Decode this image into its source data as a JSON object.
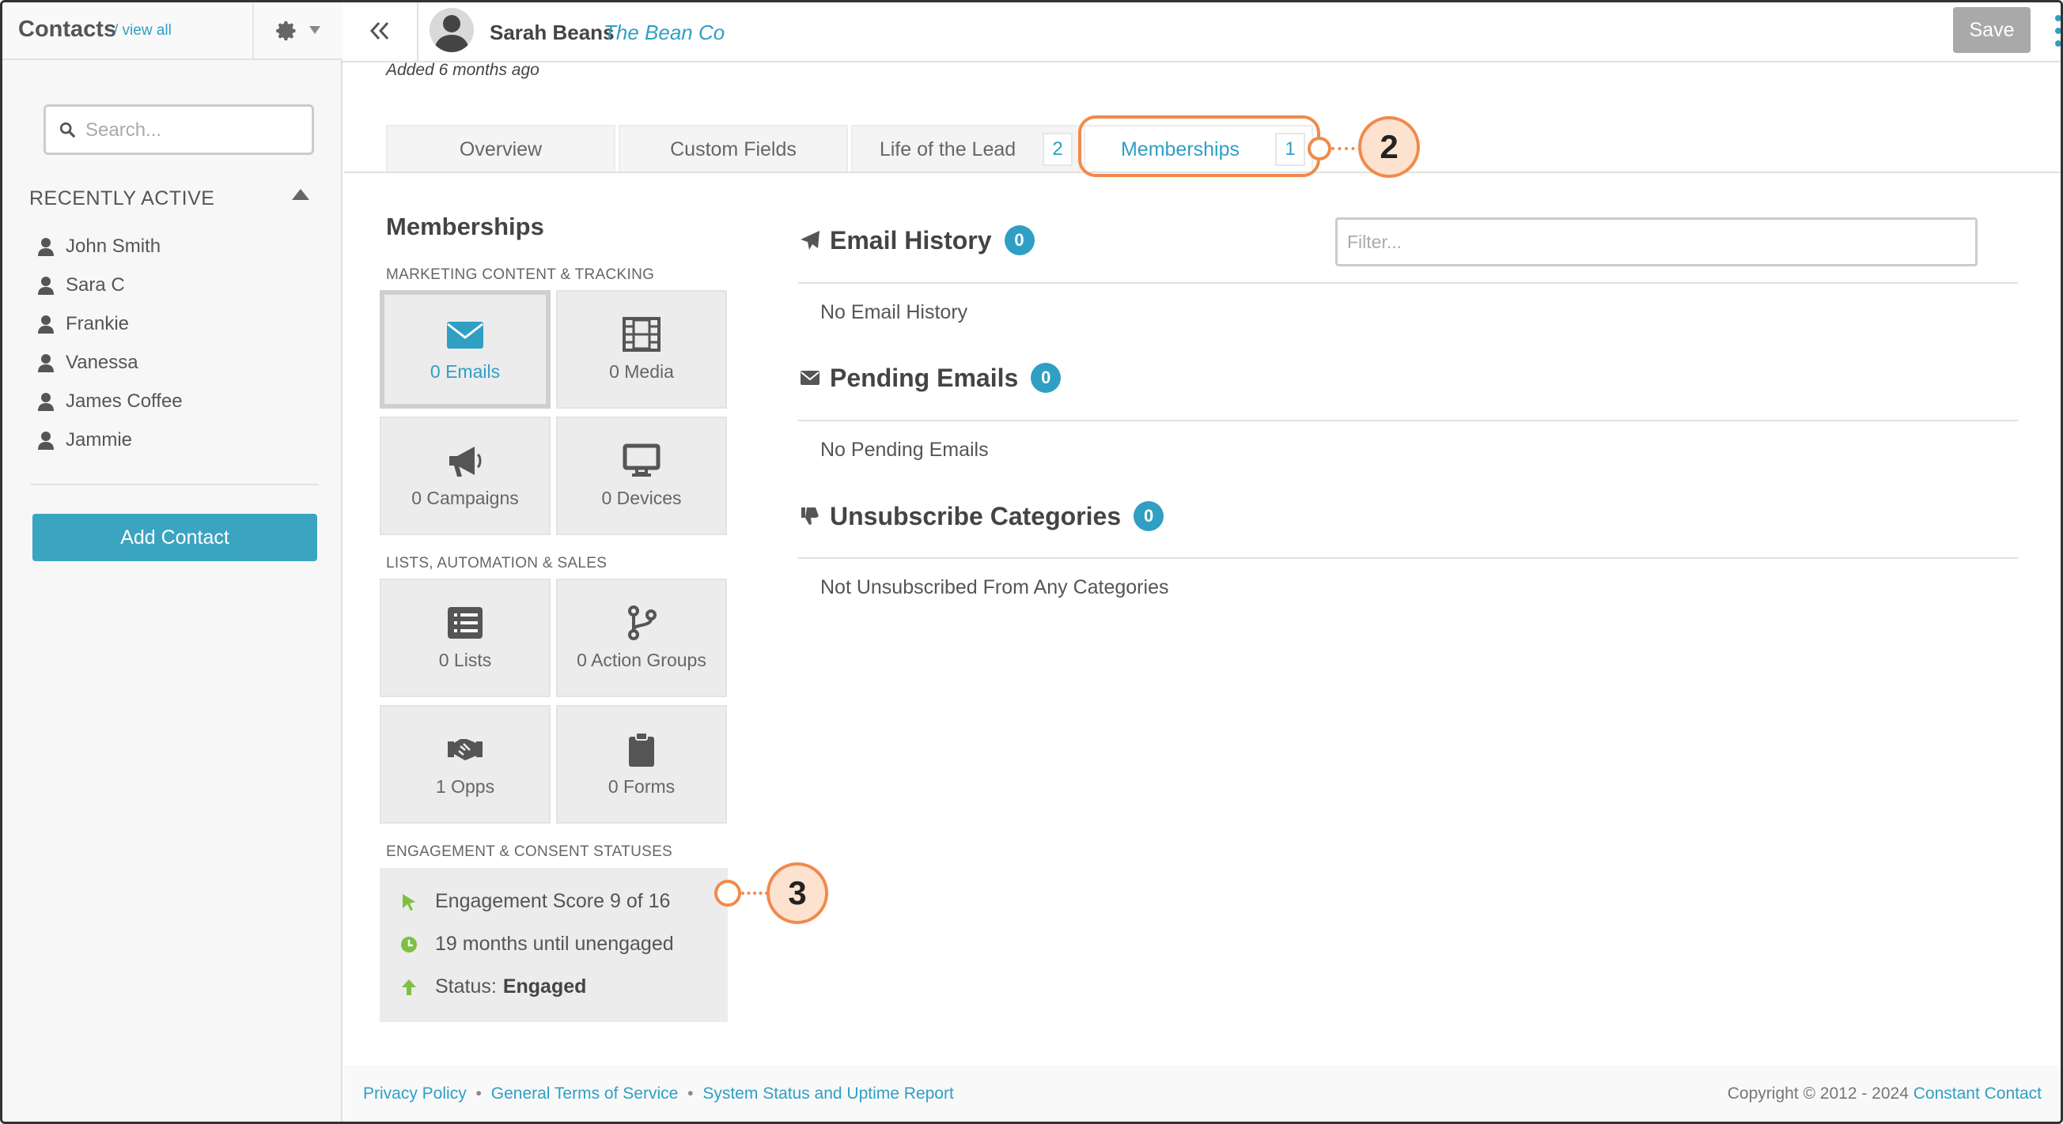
{
  "sidebar": {
    "title": "Contacts",
    "view_all": "/ view all",
    "search_placeholder": "Search...",
    "recent_title": "RECENTLY ACTIVE",
    "recent": [
      "John Smith",
      "Sara C",
      "Frankie",
      "Vanessa",
      "James Coffee",
      "Jammie"
    ],
    "add_contact": "Add Contact"
  },
  "header": {
    "contact_name": "Sarah Beans",
    "company": "The Bean Co",
    "save": "Save",
    "added_prefix": "Added",
    "added_when": "6 months ago"
  },
  "tabs": [
    {
      "label": "Overview",
      "count": ""
    },
    {
      "label": "Custom Fields",
      "count": ""
    },
    {
      "label": "Life of the Lead",
      "count": "2"
    },
    {
      "label": "Memberships",
      "count": "1",
      "active": true
    }
  ],
  "callouts": [
    "2",
    "3"
  ],
  "memberships": {
    "title": "Memberships",
    "section_marketing": "MARKETING CONTENT & TRACKING",
    "section_lists": "LISTS, AUTOMATION & SALES",
    "section_engagement": "ENGAGEMENT & CONSENT STATUSES",
    "tiles": {
      "emails": "0 Emails",
      "media": "0 Media",
      "campaigns": "0 Campaigns",
      "devices": "0 Devices",
      "lists": "0 Lists",
      "action_groups": "0 Action Groups",
      "opps": "1 Opps",
      "forms": "0 Forms"
    },
    "engagement": {
      "score": "Engagement Score 9 of 16",
      "until": "19 months until unengaged",
      "status_label": "Status:",
      "status_value": "Engaged"
    }
  },
  "history": {
    "filter_placeholder": "Filter...",
    "email_history": {
      "title": "Email History",
      "count": "0",
      "empty": "No Email History"
    },
    "pending_emails": {
      "title": "Pending Emails",
      "count": "0",
      "empty": "No Pending Emails"
    },
    "unsubscribe": {
      "title": "Unsubscribe Categories",
      "count": "0",
      "empty": "Not Unsubscribed From Any Categories"
    }
  },
  "footer": {
    "privacy": "Privacy Policy",
    "terms": "General Terms of Service",
    "status": "System Status and Uptime Report",
    "sep": "•",
    "copyright": "Copyright © 2012 - 2024",
    "brand": "Constant Contact"
  },
  "colors": {
    "accent": "#2f9fc4",
    "button": "#3aa4c1",
    "callout": "#f08a4b",
    "engaged_green": "#7cc142"
  }
}
